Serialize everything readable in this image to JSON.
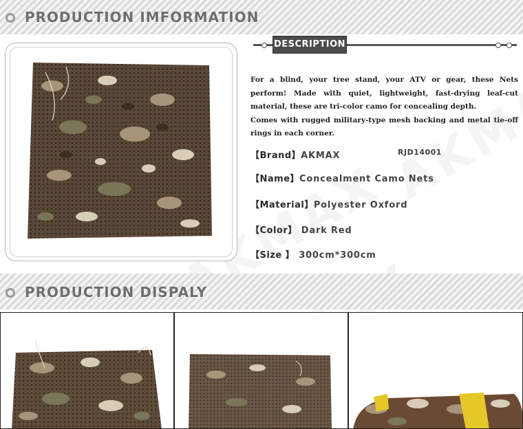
{
  "watermark": "AKMAX",
  "header": {
    "title": "PRODUCTION IMFORMATION"
  },
  "description": {
    "tab_label": "DESCRIPTION",
    "paragraphs": [
      "For a blind, your tree stand, your ATV or gear, these Nets perform! Made with quiet, lightweight, fast-drying leaf-cut material, these are tri-color camo for concealing depth.",
      "Comes with rugged military-type mesh backing and metal tie-off rings in each corner."
    ]
  },
  "specs": [
    {
      "label": "【Brand】",
      "value": "AKMAX",
      "extra": "RJD14001"
    },
    {
      "label": "【Name】",
      "value": "Concealment Camo Nets"
    },
    {
      "label": "【Material】",
      "value": "Polyester Oxford"
    },
    {
      "label": "【Color】",
      "value": "Dark Red"
    },
    {
      "label": "【Size  】",
      "value": "300cm*300cm"
    }
  ],
  "display": {
    "title": "PRODUCTION DISPALY"
  },
  "colors": {
    "camo_base": "#5c4a3a",
    "camo_dark": "#3b2d22",
    "camo_tan": "#a79479",
    "camo_light": "#d8cdb6",
    "camo_green": "#7a7658",
    "strap_yellow": "#e5c828"
  }
}
